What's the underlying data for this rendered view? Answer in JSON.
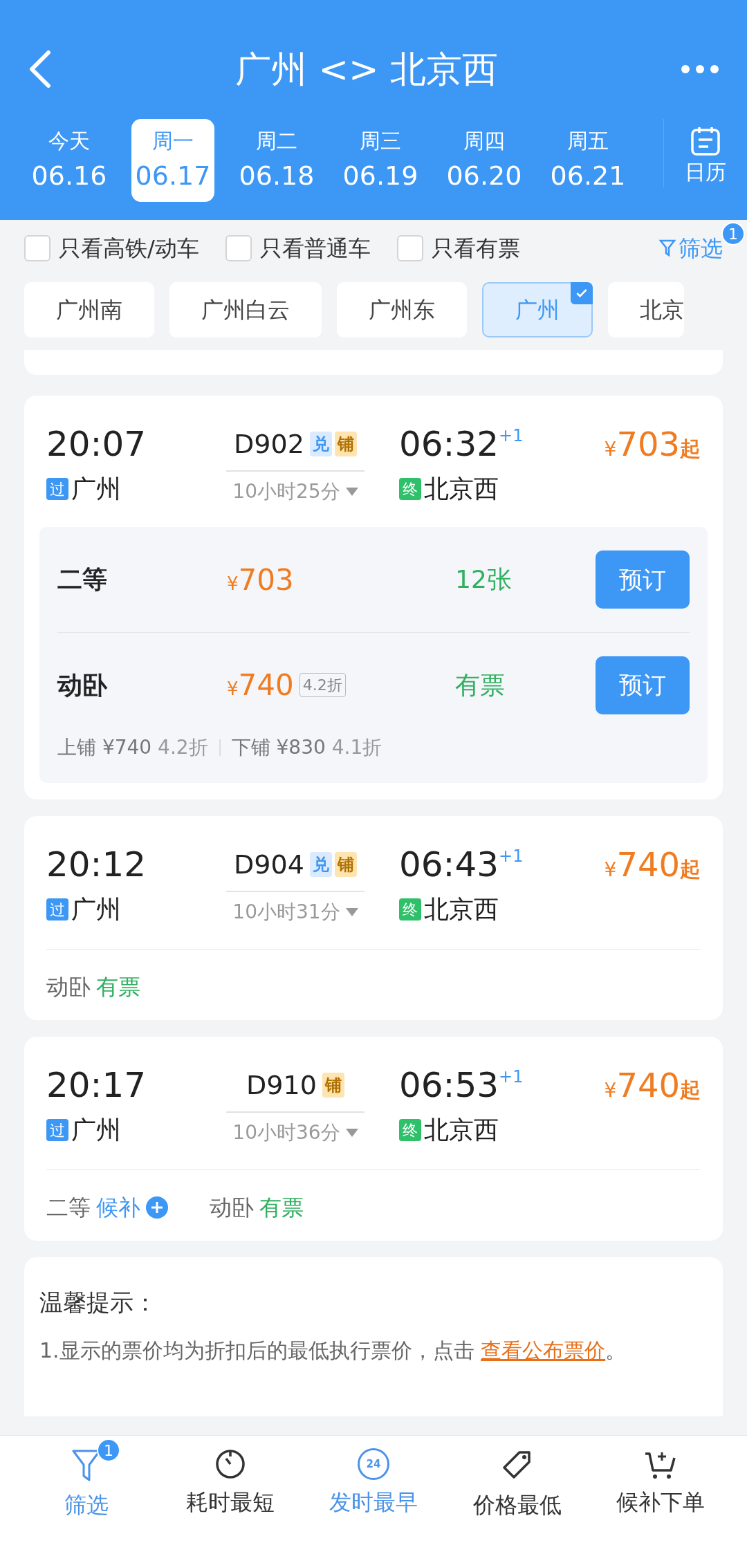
{
  "header": {
    "title": "广州 <> 北京西"
  },
  "dates": [
    {
      "weekday": "今天",
      "date": "06.16",
      "selected": false
    },
    {
      "weekday": "周一",
      "date": "06.17",
      "selected": true
    },
    {
      "weekday": "周二",
      "date": "06.18",
      "selected": false
    },
    {
      "weekday": "周三",
      "date": "06.19",
      "selected": false
    },
    {
      "weekday": "周四",
      "date": "06.20",
      "selected": false
    },
    {
      "weekday": "周五",
      "date": "06.21",
      "selected": false
    }
  ],
  "calendar": {
    "label": "日历"
  },
  "filters": [
    {
      "label": "只看高铁/动车",
      "checked": false
    },
    {
      "label": "只看普通车",
      "checked": false
    },
    {
      "label": "只看有票",
      "checked": false
    }
  ],
  "filter_button": {
    "label": "筛选",
    "badge": "1"
  },
  "stations": [
    {
      "name": "广州南",
      "selected": false
    },
    {
      "name": "广州白云",
      "selected": false
    },
    {
      "name": "广州东",
      "selected": false
    },
    {
      "name": "广州",
      "selected": true
    },
    {
      "name": "北京",
      "selected": false
    }
  ],
  "trains": [
    {
      "depart": "20:07",
      "depart_tag": "过",
      "from": "广州",
      "number": "D902",
      "tags": [
        {
          "label": "兑",
          "kind": "exchange"
        },
        {
          "label": "铺",
          "kind": "berth"
        }
      ],
      "duration": "10小时25分",
      "arrive": "06:32",
      "day_offset": "+1",
      "arrive_tag": "终",
      "to": "北京西",
      "currency": "¥",
      "price": "703",
      "price_suffix": "起",
      "expanded": true,
      "seats": [
        {
          "class": "二等",
          "currency": "¥",
          "price": "703",
          "status": "12张",
          "button": "预订"
        },
        {
          "class": "动卧",
          "currency": "¥",
          "price": "740",
          "discount": "4.2折",
          "status": "有票",
          "button": "预订"
        }
      ],
      "berths": [
        {
          "label": "上铺 ¥740",
          "discount": "4.2折"
        },
        {
          "label": "下铺 ¥830",
          "discount": "4.1折"
        }
      ]
    },
    {
      "depart": "20:12",
      "depart_tag": "过",
      "from": "广州",
      "number": "D904",
      "tags": [
        {
          "label": "兑",
          "kind": "exchange"
        },
        {
          "label": "铺",
          "kind": "berth"
        }
      ],
      "duration": "10小时31分",
      "arrive": "06:43",
      "day_offset": "+1",
      "arrive_tag": "终",
      "to": "北京西",
      "currency": "¥",
      "price": "740",
      "price_suffix": "起",
      "expanded": false,
      "summary": [
        {
          "class": "动卧",
          "status": "有票",
          "kind": "available"
        }
      ]
    },
    {
      "depart": "20:17",
      "depart_tag": "过",
      "from": "广州",
      "number": "D910",
      "tags": [
        {
          "label": "铺",
          "kind": "berth"
        }
      ],
      "duration": "10小时36分",
      "arrive": "06:53",
      "day_offset": "+1",
      "arrive_tag": "终",
      "to": "北京西",
      "currency": "¥",
      "price": "740",
      "price_suffix": "起",
      "expanded": false,
      "summary": [
        {
          "class": "二等",
          "status": "候补",
          "kind": "waitlist"
        },
        {
          "class": "动卧",
          "status": "有票",
          "kind": "available"
        }
      ]
    }
  ],
  "tips": {
    "title": "温馨提示：",
    "text": "1.显示的票价均为折扣后的最低执行票价，点击 ",
    "link": "查看公布票价",
    "tail": "。"
  },
  "bottom_nav": [
    {
      "label": "筛选",
      "kind": "filter",
      "selected": true,
      "badge": "1"
    },
    {
      "label": "耗时最短",
      "kind": "timer",
      "selected": false
    },
    {
      "label": "发时最早",
      "kind": "clock24",
      "icon_text": "24",
      "selected": true
    },
    {
      "label": "价格最低",
      "kind": "tag",
      "selected": false
    },
    {
      "label": "候补下单",
      "kind": "cart",
      "selected": false
    }
  ]
}
